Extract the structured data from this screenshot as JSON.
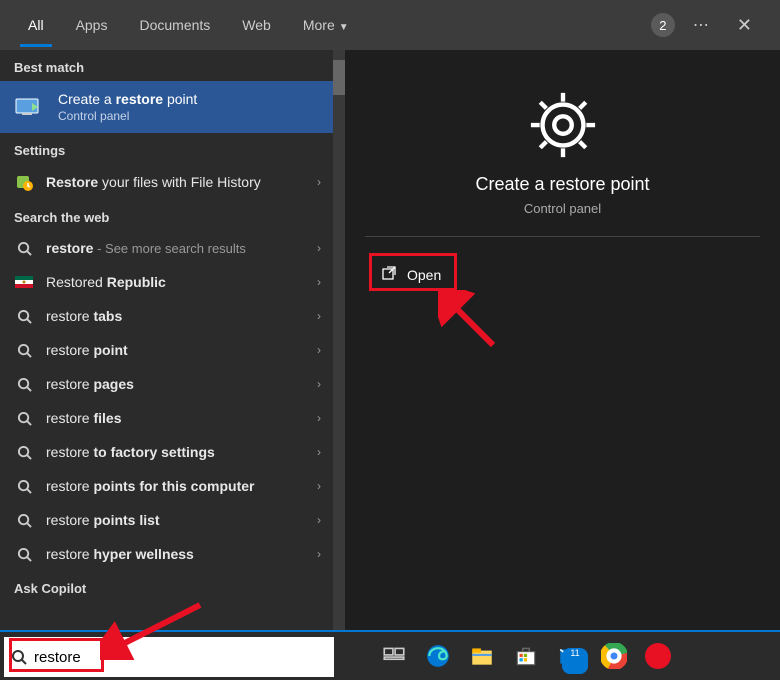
{
  "header": {
    "tabs": [
      "All",
      "Apps",
      "Documents",
      "Web",
      "More"
    ],
    "badge": "2"
  },
  "sections": {
    "best_match": "Best match",
    "settings": "Settings",
    "search_web": "Search the web",
    "ask_copilot": "Ask Copilot"
  },
  "best_match_item": {
    "title_pre": "Create a ",
    "title_bold": "restore",
    "title_post": " point",
    "subtitle": "Control panel"
  },
  "settings_items": [
    {
      "bold": "Restore",
      "rest": " your files with File History"
    }
  ],
  "web_items": [
    {
      "pre": "",
      "bold": "restore",
      "post": "",
      "dim": " - See more search results"
    },
    {
      "pre": "",
      "bold": "",
      "post": "Restored ",
      "bold2": "Republic",
      "flag": true
    },
    {
      "pre": "restore ",
      "bold": "tabs",
      "post": ""
    },
    {
      "pre": "restore ",
      "bold": "point",
      "post": ""
    },
    {
      "pre": "restore ",
      "bold": "pages",
      "post": ""
    },
    {
      "pre": "restore ",
      "bold": "files",
      "post": ""
    },
    {
      "pre": "restore ",
      "bold": "to factory settings",
      "post": ""
    },
    {
      "pre": "restore ",
      "bold": "points for this computer",
      "post": ""
    },
    {
      "pre": "restore ",
      "bold": "points list",
      "post": ""
    },
    {
      "pre": "restore ",
      "bold": "hyper wellness",
      "post": ""
    }
  ],
  "preview": {
    "title": "Create a restore point",
    "subtitle": "Control panel",
    "open": "Open"
  },
  "search": {
    "value": "restore"
  },
  "taskbar": {
    "mail_badge": "11"
  }
}
